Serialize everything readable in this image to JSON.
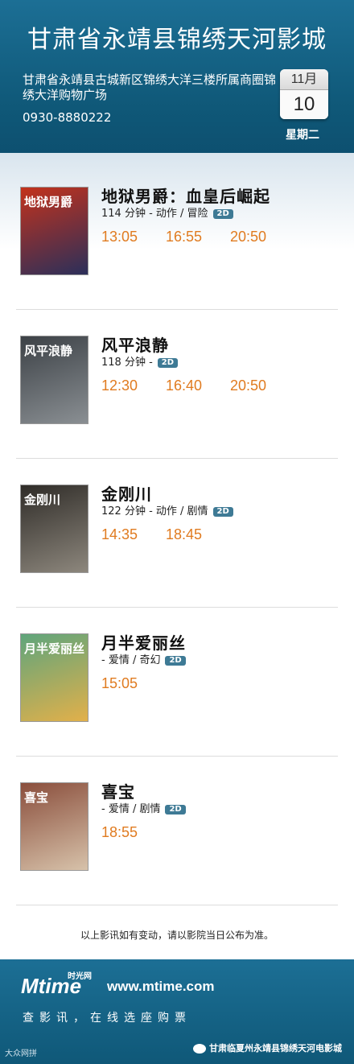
{
  "header": {
    "cinema_name": "甘肃省永靖县锦绣天河影城",
    "address": "甘肃省永靖县古城新区锦绣大洋三楼所属商圈锦绣大洋购物广场",
    "phone": "0930-8880222",
    "calendar": {
      "month": "11月",
      "day": "10",
      "weekday": "星期二"
    }
  },
  "colors": {
    "header_bg": "#136486",
    "showtime": "#e07b20",
    "badge": "#3e7a95"
  },
  "movies": [
    {
      "title": "地狱男爵：血皇后崛起",
      "meta": "114 分钟 - 动作 / 冒险",
      "format": "2D",
      "times": [
        "13:05",
        "16:55",
        "20:50"
      ],
      "poster_text": "地狱男爵",
      "poster_colors": [
        "#c3321c",
        "#2b2f5a"
      ]
    },
    {
      "title": "风平浪静",
      "meta": "118 分钟 -",
      "format": "2D",
      "times": [
        "12:30",
        "16:40",
        "20:50"
      ],
      "poster_text": "风平浪静",
      "poster_colors": [
        "#3c4146",
        "#8a8f93"
      ]
    },
    {
      "title": "金刚川",
      "meta": "122 分钟 - 动作 / 剧情",
      "format": "2D",
      "times": [
        "14:35",
        "18:45"
      ],
      "poster_text": "金刚川",
      "poster_colors": [
        "#2f2c28",
        "#8d877d"
      ]
    },
    {
      "title": "月半爱丽丝",
      "meta": "- 爱情 / 奇幻",
      "format": "2D",
      "times": [
        "15:05"
      ],
      "poster_text": "月半爱丽丝",
      "poster_colors": [
        "#5fa57c",
        "#e2b04a"
      ]
    },
    {
      "title": "喜宝",
      "meta": "- 爱情 / 剧情",
      "format": "2D",
      "times": [
        "18:55"
      ],
      "poster_text": "喜宝",
      "poster_colors": [
        "#8a4e3c",
        "#d7c2aa"
      ]
    }
  ],
  "notice": "以上影讯如有变动，请以影院当日公布为准。",
  "footer": {
    "logo": "Mtime",
    "logo_cn": "时光网",
    "site": "www.mtime.com",
    "slogan": "查影讯，在线选座购票",
    "wechat_label": "甘肃临夏州永靖县锦绣天河电影城",
    "watermark": "大众网拼"
  }
}
